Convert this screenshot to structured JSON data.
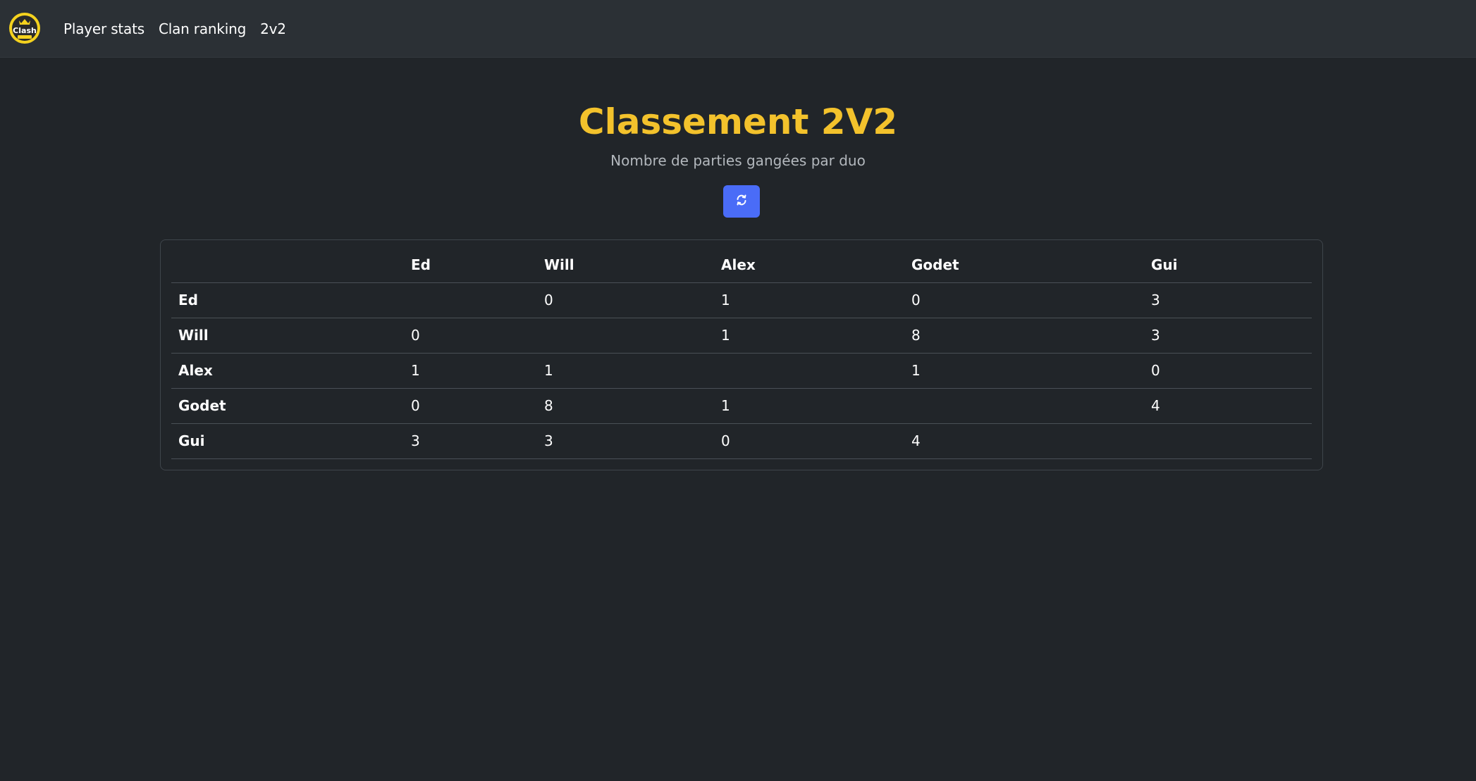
{
  "navbar": {
    "logo_text": "Clash",
    "links": [
      "Player stats",
      "Clan ranking",
      "2v2"
    ]
  },
  "page": {
    "title": "Classement 2V2",
    "subtitle": "Nombre de parties gangées par duo",
    "refresh_icon": "refresh-icon"
  },
  "colors": {
    "background": "#212529",
    "navbar": "#2b3035",
    "title": "#f3c22c",
    "button": "#4a6cf7"
  },
  "table": {
    "columns": [
      "",
      "Ed",
      "Will",
      "Alex",
      "Godet",
      "Gui"
    ],
    "rows": [
      {
        "name": "Ed",
        "cells": [
          "",
          "0",
          "1",
          "0",
          "3"
        ]
      },
      {
        "name": "Will",
        "cells": [
          "0",
          "",
          "1",
          "8",
          "3"
        ]
      },
      {
        "name": "Alex",
        "cells": [
          "1",
          "1",
          "",
          "1",
          "0"
        ]
      },
      {
        "name": "Godet",
        "cells": [
          "0",
          "8",
          "1",
          "",
          "4"
        ]
      },
      {
        "name": "Gui",
        "cells": [
          "3",
          "3",
          "0",
          "4",
          ""
        ]
      }
    ]
  }
}
